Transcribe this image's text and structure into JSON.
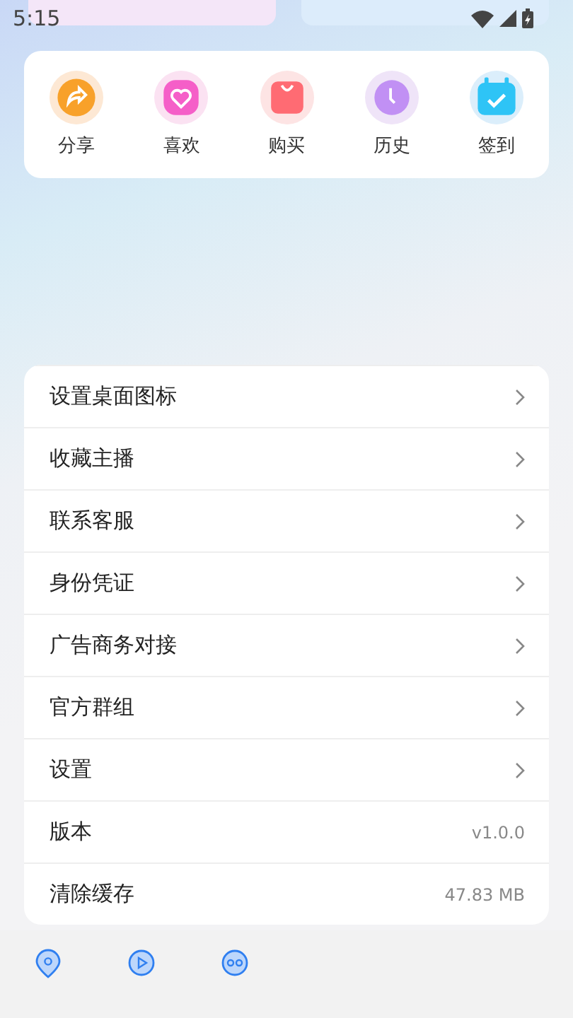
{
  "status_bar": {
    "time": "5:15"
  },
  "quick_actions": [
    {
      "label": "分享",
      "kind": "share"
    },
    {
      "label": "喜欢",
      "kind": "like"
    },
    {
      "label": "购买",
      "kind": "buy"
    },
    {
      "label": "历史",
      "kind": "history"
    },
    {
      "label": "签到",
      "kind": "checkin"
    }
  ],
  "menu": [
    {
      "label": "设置桌面图标",
      "kind": "link"
    },
    {
      "label": "收藏主播",
      "kind": "link"
    },
    {
      "label": "联系客服",
      "kind": "link"
    },
    {
      "label": "身份凭证",
      "kind": "link"
    },
    {
      "label": "广告商务对接",
      "kind": "link"
    },
    {
      "label": "官方群组",
      "kind": "link"
    },
    {
      "label": "设置",
      "kind": "link"
    },
    {
      "label": "版本",
      "kind": "value",
      "value": "v1.0.0"
    },
    {
      "label": "清除缓存",
      "kind": "value",
      "value": "47.83 MB"
    }
  ],
  "bottom_nav": [
    {
      "kind": "pin"
    },
    {
      "kind": "play"
    },
    {
      "kind": "face"
    }
  ]
}
